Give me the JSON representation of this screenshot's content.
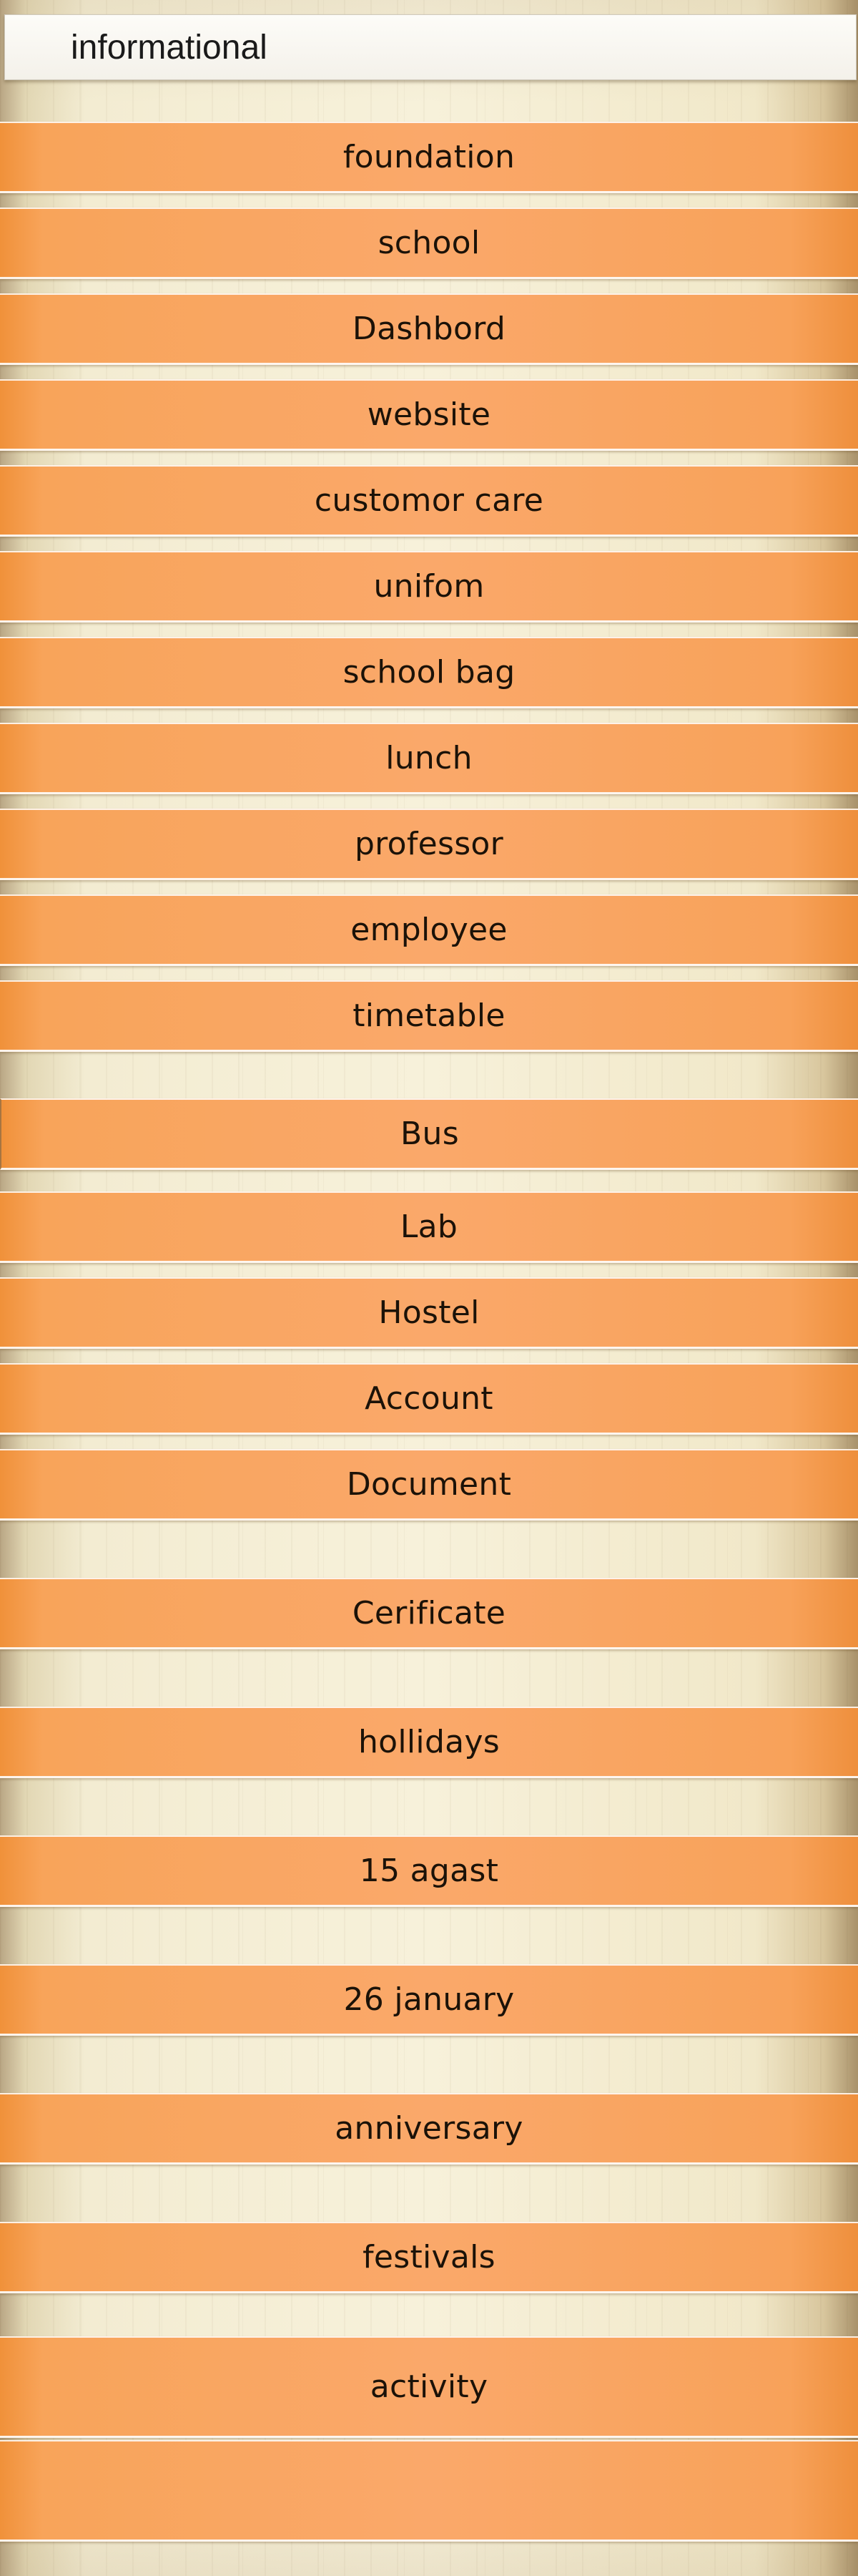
{
  "header": {
    "title": "informational"
  },
  "menu": {
    "items": [
      {
        "label": "foundation"
      },
      {
        "label": "school"
      },
      {
        "label": "Dashbord"
      },
      {
        "label": "website"
      },
      {
        "label": "customor care"
      },
      {
        "label": "unifom"
      },
      {
        "label": "school bag"
      },
      {
        "label": "lunch"
      },
      {
        "label": "professor"
      },
      {
        "label": "employee"
      },
      {
        "label": "timetable"
      },
      {
        "label": "Bus"
      },
      {
        "label": "Lab"
      },
      {
        "label": "Hostel"
      },
      {
        "label": "Account"
      },
      {
        "label": "Document"
      },
      {
        "label": "Cerificate"
      },
      {
        "label": "hollidays"
      },
      {
        "label": "15 agast"
      },
      {
        "label": "26 january"
      },
      {
        "label": "anniversary"
      },
      {
        "label": "festivals"
      },
      {
        "label": "activity"
      },
      {
        "label": ""
      }
    ]
  },
  "colors": {
    "item_orange": "#faa86a",
    "item_orange_edge": "#f0913a",
    "background_cream": "#f7f1da",
    "header_white": "#fdfcf8"
  }
}
